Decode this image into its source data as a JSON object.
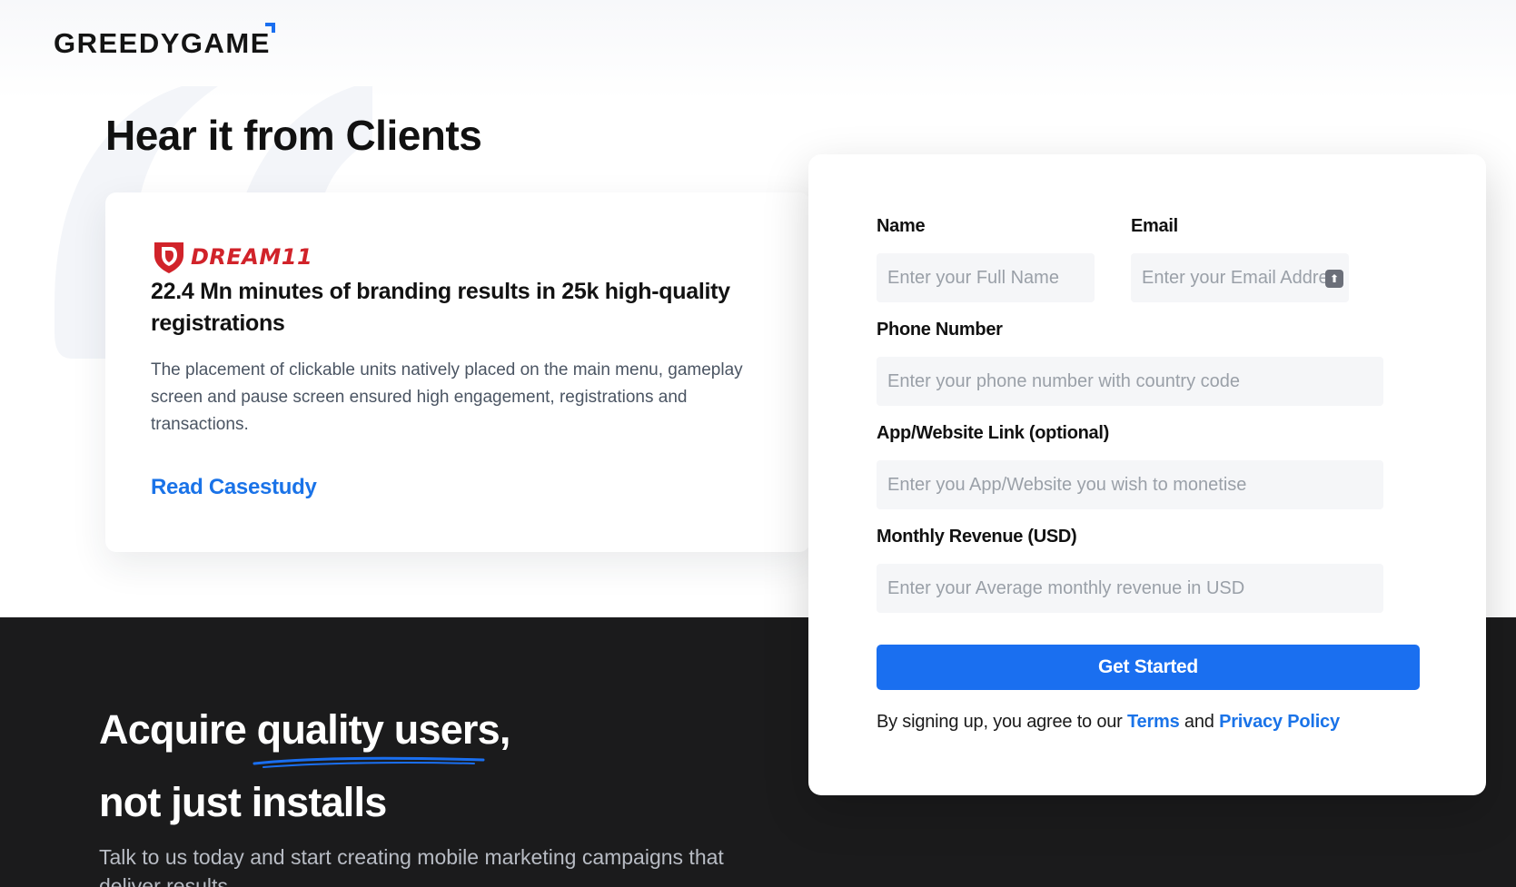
{
  "header": {
    "logo_text": "GREEDYGAME"
  },
  "testimonials": {
    "title": "Hear it from Clients",
    "card": {
      "client_logo_text": "DREAM11",
      "headline": "22.4 Mn minutes of branding results in 25k high-quality registrations",
      "body": "The placement of clickable units natively placed on the main menu, gameplay screen and pause screen ensured high engagement, registrations and transactions.",
      "link_label": "Read Casestudy"
    }
  },
  "hero": {
    "line1_part1": "Acquire ",
    "line1_highlight": "quality users,",
    "line2": "not just installs",
    "subtitle": "Talk to us today and start creating mobile marketing campaigns that deliver results"
  },
  "form": {
    "name_label": "Name",
    "name_placeholder": "Enter your Full Name",
    "email_label": "Email",
    "email_placeholder": "Enter your Email Address",
    "phone_label": "Phone Number",
    "phone_placeholder": "Enter your phone number with country code",
    "link_label": "App/Website Link (optional)",
    "link_placeholder": "Enter you App/Website you wish to monetise",
    "revenue_label": "Monthly Revenue (USD)",
    "revenue_placeholder": "Enter your Average monthly revenue in USD",
    "submit_label": "Get Started",
    "legal_prefix": "By signing up, you agree to our",
    "legal_terms": "Terms",
    "legal_and": "and",
    "legal_privacy": "Privacy Policy"
  },
  "colors": {
    "brand_blue": "#1a6ff0",
    "link_blue": "#1a73e8",
    "dream11_red": "#d1232a",
    "dark_band": "#1b1b1c"
  },
  "icons": {
    "logo_mark": "corner-bracket-icon",
    "quote": "quote-mark-icon",
    "client_logo": "dream11-shield-icon",
    "underline": "scribble-underline-icon"
  }
}
